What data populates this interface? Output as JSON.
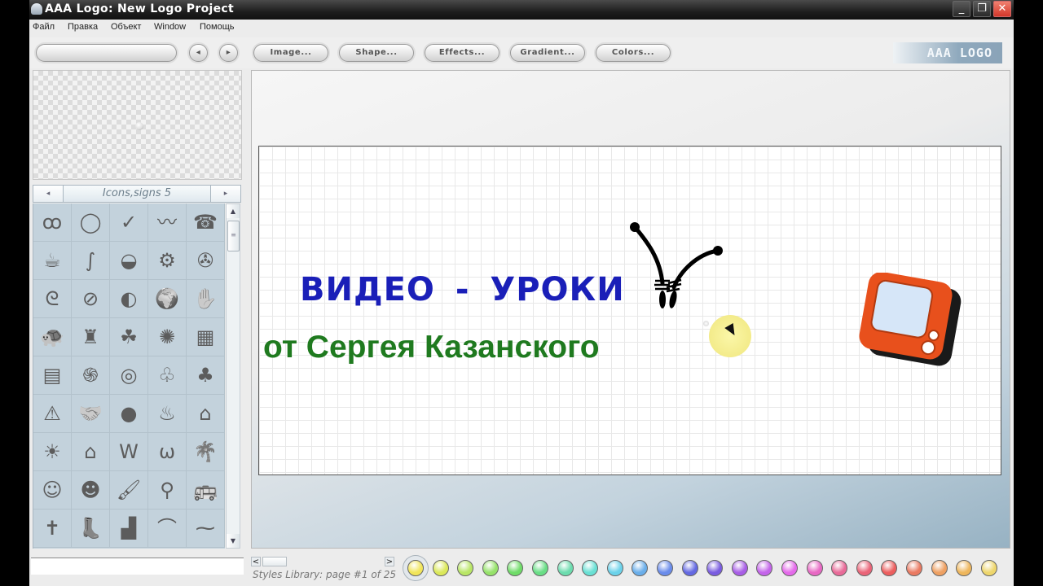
{
  "window": {
    "title": "AAA Logo: New Logo Project",
    "controls": {
      "minimize": "_",
      "restore": "❐",
      "close": "✕"
    }
  },
  "menu": [
    "Файл",
    "Правка",
    "Объект",
    "Window",
    "Помощь"
  ],
  "toolbar": {
    "object_field": "",
    "prev_label": "◂",
    "next_label": "▸",
    "buttons": [
      "Image...",
      "Shape...",
      "Effects...",
      "Gradient...",
      "Colors..."
    ],
    "brand": "AAA LOGO"
  },
  "library": {
    "title": "Icons,signs 5",
    "prev": "◂",
    "next": "▸",
    "scroll_up": "▲",
    "scroll_down": "▼",
    "thumb_grip": "≡",
    "icons": [
      {
        "name": "three-faces",
        "glyph": "ꝏ"
      },
      {
        "name": "ring",
        "glyph": "◯"
      },
      {
        "name": "swoosh",
        "glyph": "✓"
      },
      {
        "name": "wave",
        "glyph": "〰"
      },
      {
        "name": "telephone",
        "glyph": "☎"
      },
      {
        "name": "coffee-cup-box",
        "glyph": "☕"
      },
      {
        "name": "squiggle",
        "glyph": "∫"
      },
      {
        "name": "teacup",
        "glyph": "◒"
      },
      {
        "name": "gears",
        "glyph": "⚙"
      },
      {
        "name": "swirl-circle",
        "glyph": "✇"
      },
      {
        "name": "curl",
        "glyph": "ᘓ"
      },
      {
        "name": "no-smoking",
        "glyph": "⊘"
      },
      {
        "name": "moon-phase",
        "glyph": "◐"
      },
      {
        "name": "globe",
        "glyph": "🌍"
      },
      {
        "name": "handprint",
        "glyph": "✋"
      },
      {
        "name": "turtle",
        "glyph": "🐢"
      },
      {
        "name": "castle-person",
        "glyph": "♜"
      },
      {
        "name": "clover",
        "glyph": "☘"
      },
      {
        "name": "splat",
        "glyph": "✺"
      },
      {
        "name": "brick-wall",
        "glyph": "▦"
      },
      {
        "name": "calculator",
        "glyph": "▤"
      },
      {
        "name": "spiral",
        "glyph": "֍"
      },
      {
        "name": "spiral-2",
        "glyph": "◎"
      },
      {
        "name": "tree-outline",
        "glyph": "♧"
      },
      {
        "name": "tree",
        "glyph": "♣"
      },
      {
        "name": "fire-warning",
        "glyph": "⚠"
      },
      {
        "name": "handshake",
        "glyph": "🤝"
      },
      {
        "name": "fire-circle",
        "glyph": "●"
      },
      {
        "name": "flames",
        "glyph": "♨"
      },
      {
        "name": "schoolhouse",
        "glyph": "⌂"
      },
      {
        "name": "sun-house",
        "glyph": "☀"
      },
      {
        "name": "house",
        "glyph": "⌂"
      },
      {
        "name": "wing-w",
        "glyph": "W"
      },
      {
        "name": "wing-w-2",
        "glyph": "ѡ"
      },
      {
        "name": "palm-tree",
        "glyph": "🌴"
      },
      {
        "name": "girl-face",
        "glyph": "☺"
      },
      {
        "name": "girl-face-filled",
        "glyph": "☻"
      },
      {
        "name": "paint-brush",
        "glyph": "🖌"
      },
      {
        "name": "plunger",
        "glyph": "⚲"
      },
      {
        "name": "bus",
        "glyph": "🚌"
      },
      {
        "name": "stick-figure",
        "glyph": "✝"
      },
      {
        "name": "boot",
        "glyph": "👢"
      },
      {
        "name": "boot-2",
        "glyph": "▟"
      },
      {
        "name": "arc",
        "glyph": "⌒"
      },
      {
        "name": "crown-line",
        "glyph": "⁓"
      }
    ]
  },
  "canvas": {
    "line1": "ВИДЕО  -  УРОКИ",
    "line1_color": "#1a1fb8",
    "line2": "от Сергея Казанского",
    "line2_color": "#1f7a1f",
    "tv_colors": {
      "frame": "#e8501c",
      "screen": "#d6e6f8"
    }
  },
  "styles_library": {
    "caption": "Styles Library: page #1 of 25",
    "prev": "<",
    "next": ">",
    "selected_index": 0,
    "swatches": [
      "#f1e55a",
      "#dbe85a",
      "#b9e666",
      "#96e26a",
      "#6fdc68",
      "#69de86",
      "#6cdcae",
      "#69e0d4",
      "#6bd2ea",
      "#6aaeea",
      "#6a8ceb",
      "#6469e2",
      "#7a5ce0",
      "#a85ee6",
      "#c464ea",
      "#e46aea",
      "#e868c4",
      "#e86a98",
      "#ea6478",
      "#ec5e5e",
      "#ea7a62",
      "#eea062",
      "#eeb65c",
      "#eed66c"
    ]
  },
  "canvas_field": ""
}
